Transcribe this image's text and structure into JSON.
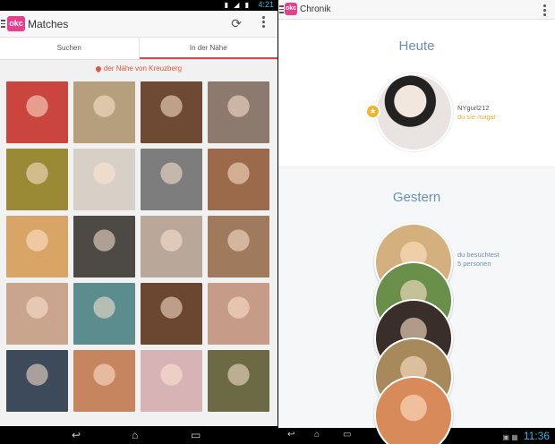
{
  "left": {
    "status": {
      "time": "4:21"
    },
    "app": {
      "logo": "okc",
      "title": "Matches"
    },
    "icons": {
      "refresh": "refresh-icon",
      "overflow": "overflow-menu-icon",
      "menu": "hamburger-icon"
    },
    "tabs": [
      {
        "label": "Suchen"
      },
      {
        "label": "In der Nähe"
      }
    ],
    "location": "der Nähe von Kreuzberg",
    "photos": [
      {
        "color": "#c9453e"
      },
      {
        "color": "#b59f7c"
      },
      {
        "color": "#6e4a35"
      },
      {
        "color": "#8d7a6e"
      },
      {
        "color": "#9a8a35"
      },
      {
        "color": "#d8cfc6"
      },
      {
        "color": "#7d7d7d"
      },
      {
        "color": "#9b6a4a"
      },
      {
        "color": "#d9a566"
      },
      {
        "color": "#4d4a46"
      },
      {
        "color": "#b9a89a"
      },
      {
        "color": "#a07a5d"
      },
      {
        "color": "#caa58d"
      },
      {
        "color": "#5b8c8e"
      },
      {
        "color": "#6b4631"
      },
      {
        "color": "#c69c88"
      },
      {
        "color": "#3c4a5a"
      },
      {
        "color": "#c7855f"
      },
      {
        "color": "#d7b3b6"
      },
      {
        "color": "#6b6a44"
      }
    ]
  },
  "right": {
    "status": {
      "time": "11:36"
    },
    "app": {
      "logo": "okc",
      "title": "Chronik"
    },
    "today": {
      "heading": "Heute",
      "name": "NYgurl212",
      "subtitle": "du sie magst"
    },
    "yesterday": {
      "heading": "Gestern",
      "line1": "du besuchtest",
      "line2": "5 personen",
      "photos": [
        {
          "color": "#d3b07e"
        },
        {
          "color": "#6a8f4a"
        },
        {
          "color": "#3a2e2a"
        },
        {
          "color": "#a8895c"
        },
        {
          "color": "#d98a5a"
        }
      ]
    }
  }
}
